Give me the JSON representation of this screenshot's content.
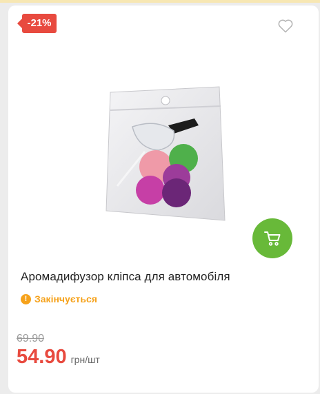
{
  "product": {
    "discount": "-21%",
    "title": "Аромадифузор кліпса для автомобіля",
    "stock_status": "Закінчується",
    "old_price": "69.90",
    "price": "54.90",
    "unit": "грн/шт"
  },
  "icons": {
    "wishlist": "heart-outline-icon",
    "cart": "shopping-cart-icon",
    "stock": "exclamation-circle-icon"
  },
  "colors": {
    "discount": "#e84a3f",
    "cart": "#68b939",
    "stock": "#f6a21b",
    "price": "#e84a3f"
  }
}
